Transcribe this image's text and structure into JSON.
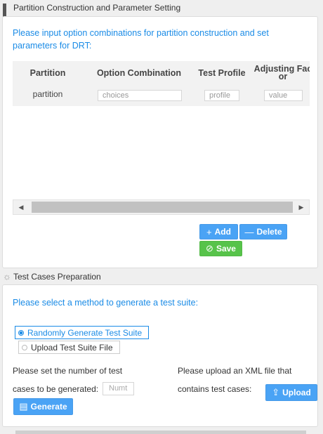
{
  "partition": {
    "header_title": "Partition Construction and Parameter Setting",
    "prompt": "Please input option combinations for partition construction and set parameters for DRT:",
    "table": {
      "columns": [
        "Partition",
        "Option Combination",
        "Test Profile"
      ],
      "column_4_line1": "Adjusting Fac",
      "column_4_line2": "or",
      "row": {
        "partition": "partition",
        "choices_placeholder": "choices",
        "profile_placeholder": "profile",
        "value_placeholder": "value"
      }
    },
    "buttons": {
      "add": "Add",
      "delete": "Delete",
      "save": "Save"
    }
  },
  "testcases": {
    "header_title": "Test Cases Preparation",
    "prompt": "Please select a method to generate a test suite:",
    "options": [
      {
        "label": "Randomly Generate Test Suite",
        "selected": true
      },
      {
        "label": "Upload Test Suite File",
        "selected": false
      }
    ],
    "number_label_line1": "Please set the number of test",
    "number_label_line2": "cases to be generated:",
    "number_placeholder": "Numt",
    "upload_label_line1": "Please upload an XML file that",
    "upload_label_line2": "contains test cases:",
    "generate_button": "Generate",
    "upload_button": "Upload"
  },
  "colors": {
    "accent": "#1a8be6",
    "button_blue": "#4aa3f5",
    "button_green": "#57c34a"
  }
}
